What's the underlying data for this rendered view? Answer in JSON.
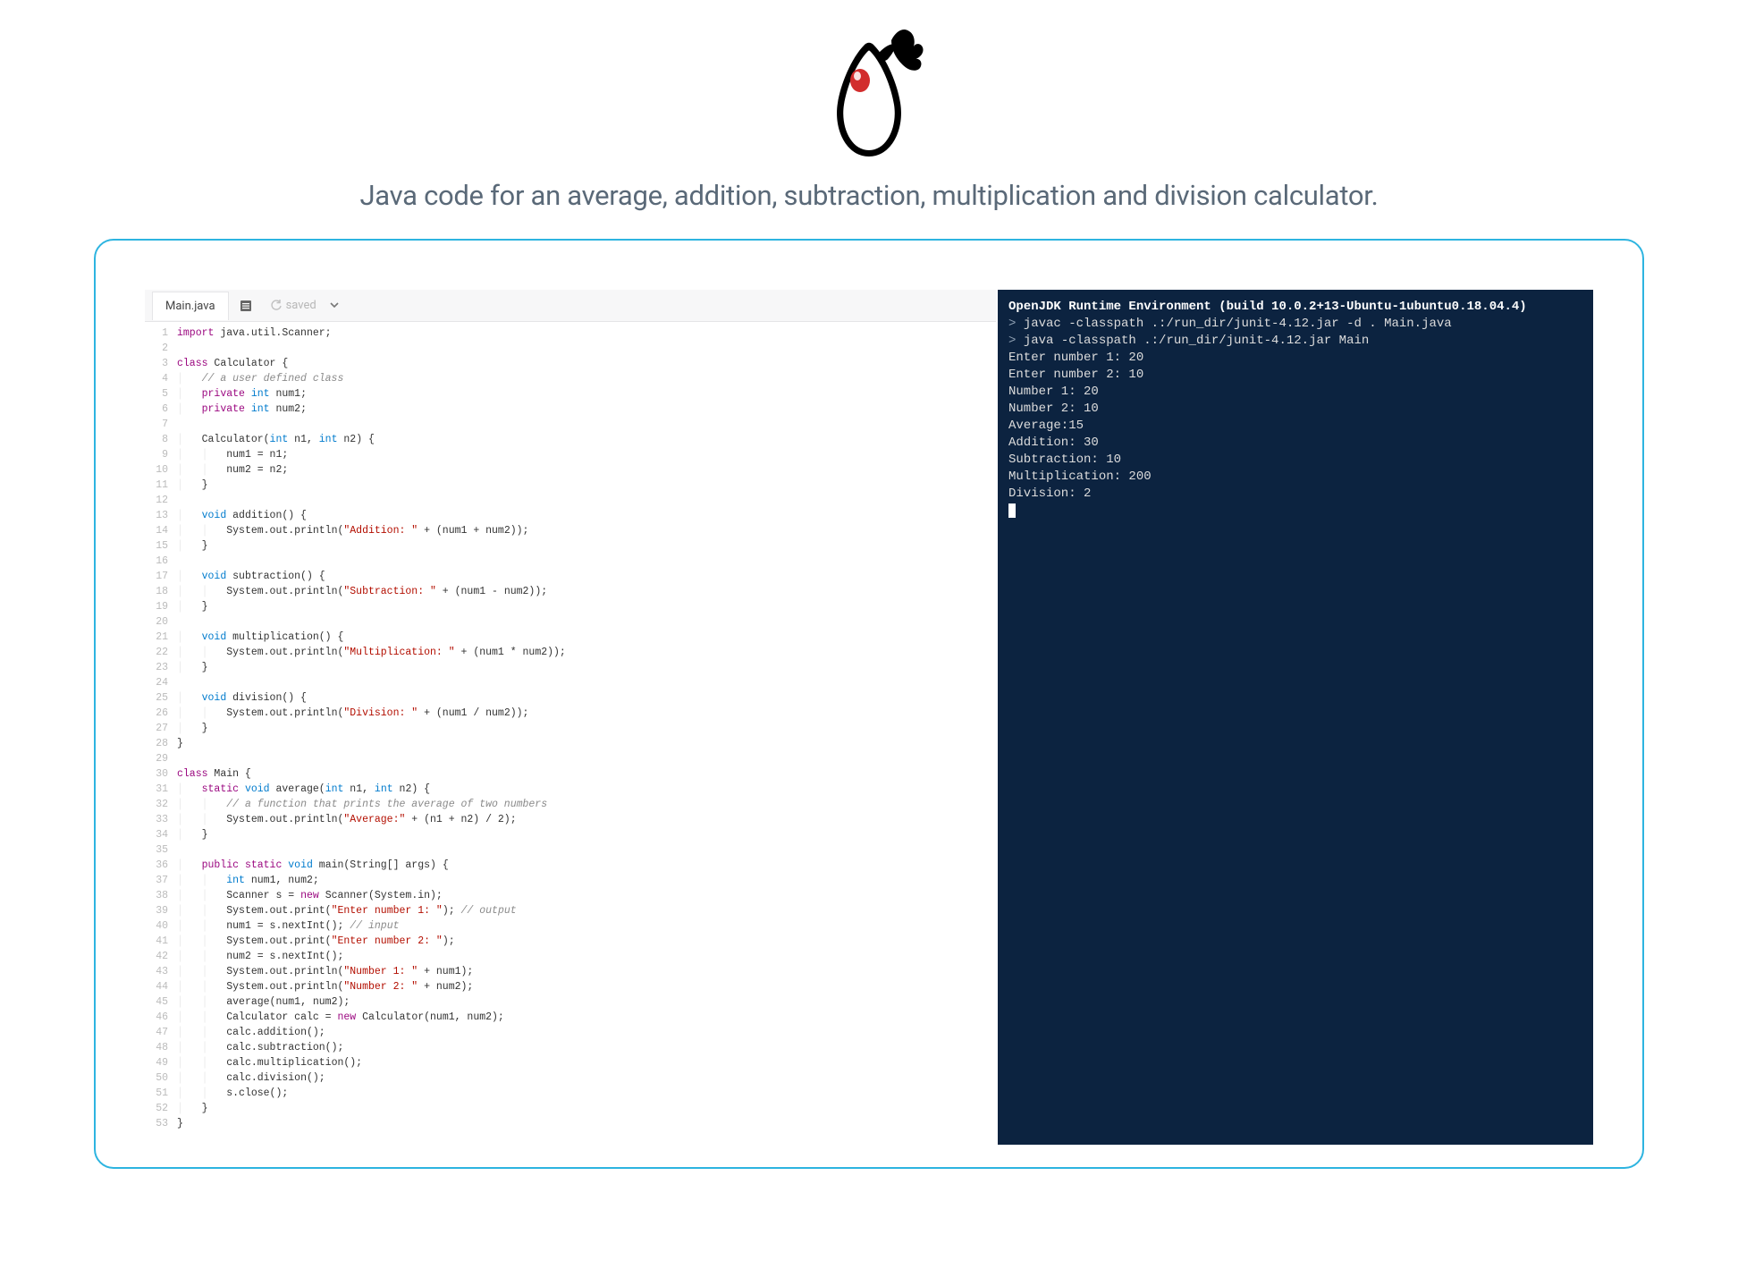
{
  "subtitle": "Java code for an average, addition, subtraction, multiplication and division calculator.",
  "tab": {
    "filename": "Main.java",
    "saved_label": "saved"
  },
  "code_lines": [
    [
      {
        "t": "kw",
        "v": "import"
      },
      {
        "t": "",
        "v": " java.util.Scanner;"
      }
    ],
    [],
    [
      {
        "t": "kw",
        "v": "class"
      },
      {
        "t": "",
        "v": " Calculator {"
      }
    ],
    [
      {
        "t": "",
        "v": "    "
      },
      {
        "t": "cmt",
        "v": "// a user defined class"
      }
    ],
    [
      {
        "t": "",
        "v": "    "
      },
      {
        "t": "kw",
        "v": "private"
      },
      {
        "t": "",
        "v": " "
      },
      {
        "t": "typ",
        "v": "int"
      },
      {
        "t": "",
        "v": " num1;"
      }
    ],
    [
      {
        "t": "",
        "v": "    "
      },
      {
        "t": "kw",
        "v": "private"
      },
      {
        "t": "",
        "v": " "
      },
      {
        "t": "typ",
        "v": "int"
      },
      {
        "t": "",
        "v": " num2;"
      }
    ],
    [],
    [
      {
        "t": "",
        "v": "    Calculator("
      },
      {
        "t": "typ",
        "v": "int"
      },
      {
        "t": "",
        "v": " n1, "
      },
      {
        "t": "typ",
        "v": "int"
      },
      {
        "t": "",
        "v": " n2) {"
      }
    ],
    [
      {
        "t": "",
        "v": "        num1 = n1;"
      }
    ],
    [
      {
        "t": "",
        "v": "        num2 = n2;"
      }
    ],
    [
      {
        "t": "",
        "v": "    }"
      }
    ],
    [],
    [
      {
        "t": "",
        "v": "    "
      },
      {
        "t": "typ",
        "v": "void"
      },
      {
        "t": "",
        "v": " addition() {"
      }
    ],
    [
      {
        "t": "",
        "v": "        System.out.println("
      },
      {
        "t": "str",
        "v": "\"Addition: \""
      },
      {
        "t": "",
        "v": " + (num1 + num2));"
      }
    ],
    [
      {
        "t": "",
        "v": "    }"
      }
    ],
    [],
    [
      {
        "t": "",
        "v": "    "
      },
      {
        "t": "typ",
        "v": "void"
      },
      {
        "t": "",
        "v": " subtraction() {"
      }
    ],
    [
      {
        "t": "",
        "v": "        System.out.println("
      },
      {
        "t": "str",
        "v": "\"Subtraction: \""
      },
      {
        "t": "",
        "v": " + (num1 - num2));"
      }
    ],
    [
      {
        "t": "",
        "v": "    }"
      }
    ],
    [],
    [
      {
        "t": "",
        "v": "    "
      },
      {
        "t": "typ",
        "v": "void"
      },
      {
        "t": "",
        "v": " multiplication() {"
      }
    ],
    [
      {
        "t": "",
        "v": "        System.out.println("
      },
      {
        "t": "str",
        "v": "\"Multiplication: \""
      },
      {
        "t": "",
        "v": " + (num1 * num2));"
      }
    ],
    [
      {
        "t": "",
        "v": "    }"
      }
    ],
    [],
    [
      {
        "t": "",
        "v": "    "
      },
      {
        "t": "typ",
        "v": "void"
      },
      {
        "t": "",
        "v": " division() {"
      }
    ],
    [
      {
        "t": "",
        "v": "        System.out.println("
      },
      {
        "t": "str",
        "v": "\"Division: \""
      },
      {
        "t": "",
        "v": " + (num1 / num2));"
      }
    ],
    [
      {
        "t": "",
        "v": "    }"
      }
    ],
    [
      {
        "t": "",
        "v": "}"
      }
    ],
    [],
    [
      {
        "t": "kw",
        "v": "class"
      },
      {
        "t": "",
        "v": " Main {"
      }
    ],
    [
      {
        "t": "",
        "v": "    "
      },
      {
        "t": "kw",
        "v": "static"
      },
      {
        "t": "",
        "v": " "
      },
      {
        "t": "typ",
        "v": "void"
      },
      {
        "t": "",
        "v": " average("
      },
      {
        "t": "typ",
        "v": "int"
      },
      {
        "t": "",
        "v": " n1, "
      },
      {
        "t": "typ",
        "v": "int"
      },
      {
        "t": "",
        "v": " n2) {"
      }
    ],
    [
      {
        "t": "",
        "v": "        "
      },
      {
        "t": "cmt",
        "v": "// a function that prints the average of two numbers"
      }
    ],
    [
      {
        "t": "",
        "v": "        System.out.println("
      },
      {
        "t": "str",
        "v": "\"Average:\""
      },
      {
        "t": "",
        "v": " + (n1 + n2) / 2);"
      }
    ],
    [
      {
        "t": "",
        "v": "    }"
      }
    ],
    [],
    [
      {
        "t": "",
        "v": "    "
      },
      {
        "t": "kw",
        "v": "public"
      },
      {
        "t": "",
        "v": " "
      },
      {
        "t": "kw",
        "v": "static"
      },
      {
        "t": "",
        "v": " "
      },
      {
        "t": "typ",
        "v": "void"
      },
      {
        "t": "",
        "v": " main(String[] args) {"
      }
    ],
    [
      {
        "t": "",
        "v": "        "
      },
      {
        "t": "typ",
        "v": "int"
      },
      {
        "t": "",
        "v": " num1, num2;"
      }
    ],
    [
      {
        "t": "",
        "v": "        Scanner s = "
      },
      {
        "t": "kw",
        "v": "new"
      },
      {
        "t": "",
        "v": " Scanner(System.in);"
      }
    ],
    [
      {
        "t": "",
        "v": "        System.out.print("
      },
      {
        "t": "str",
        "v": "\"Enter number 1: \""
      },
      {
        "t": "",
        "v": "); "
      },
      {
        "t": "cmt",
        "v": "// output"
      }
    ],
    [
      {
        "t": "",
        "v": "        num1 = s.nextInt(); "
      },
      {
        "t": "cmt",
        "v": "// input"
      }
    ],
    [
      {
        "t": "",
        "v": "        System.out.print("
      },
      {
        "t": "str",
        "v": "\"Enter number 2: \""
      },
      {
        "t": "",
        "v": ");"
      }
    ],
    [
      {
        "t": "",
        "v": "        num2 = s.nextInt();"
      }
    ],
    [
      {
        "t": "",
        "v": "        System.out.println("
      },
      {
        "t": "str",
        "v": "\"Number 1: \""
      },
      {
        "t": "",
        "v": " + num1);"
      }
    ],
    [
      {
        "t": "",
        "v": "        System.out.println("
      },
      {
        "t": "str",
        "v": "\"Number 2: \""
      },
      {
        "t": "",
        "v": " + num2);"
      }
    ],
    [
      {
        "t": "",
        "v": "        average(num1, num2);"
      }
    ],
    [
      {
        "t": "",
        "v": "        Calculator calc = "
      },
      {
        "t": "kw",
        "v": "new"
      },
      {
        "t": "",
        "v": " Calculator(num1, num2);"
      }
    ],
    [
      {
        "t": "",
        "v": "        calc.addition();"
      }
    ],
    [
      {
        "t": "",
        "v": "        calc.subtraction();"
      }
    ],
    [
      {
        "t": "",
        "v": "        calc.multiplication();"
      }
    ],
    [
      {
        "t": "",
        "v": "        calc.division();"
      }
    ],
    [
      {
        "t": "",
        "v": "        s.close();"
      }
    ],
    [
      {
        "t": "",
        "v": "    }"
      }
    ],
    [
      {
        "t": "",
        "v": "}"
      }
    ]
  ],
  "terminal": {
    "lines": [
      {
        "type": "bold",
        "text": "OpenJDK Runtime Environment (build 10.0.2+13-Ubuntu-1ubuntu0.18.04.4)"
      },
      {
        "type": "cmd",
        "prompt": "> ",
        "text": "javac -classpath .:/run_dir/junit-4.12.jar -d . Main.java"
      },
      {
        "type": "cmd",
        "prompt": "> ",
        "text": "java -classpath .:/run_dir/junit-4.12.jar Main"
      },
      {
        "type": "out",
        "text": "Enter number 1: 20"
      },
      {
        "type": "out",
        "text": "Enter number 2: 10"
      },
      {
        "type": "out",
        "text": "Number 1: 20"
      },
      {
        "type": "out",
        "text": "Number 2: 10"
      },
      {
        "type": "out",
        "text": "Average:15"
      },
      {
        "type": "out",
        "text": "Addition: 30"
      },
      {
        "type": "out",
        "text": "Subtraction: 10"
      },
      {
        "type": "out",
        "text": "Multiplication: 200"
      },
      {
        "type": "out",
        "text": "Division: 2"
      }
    ]
  }
}
